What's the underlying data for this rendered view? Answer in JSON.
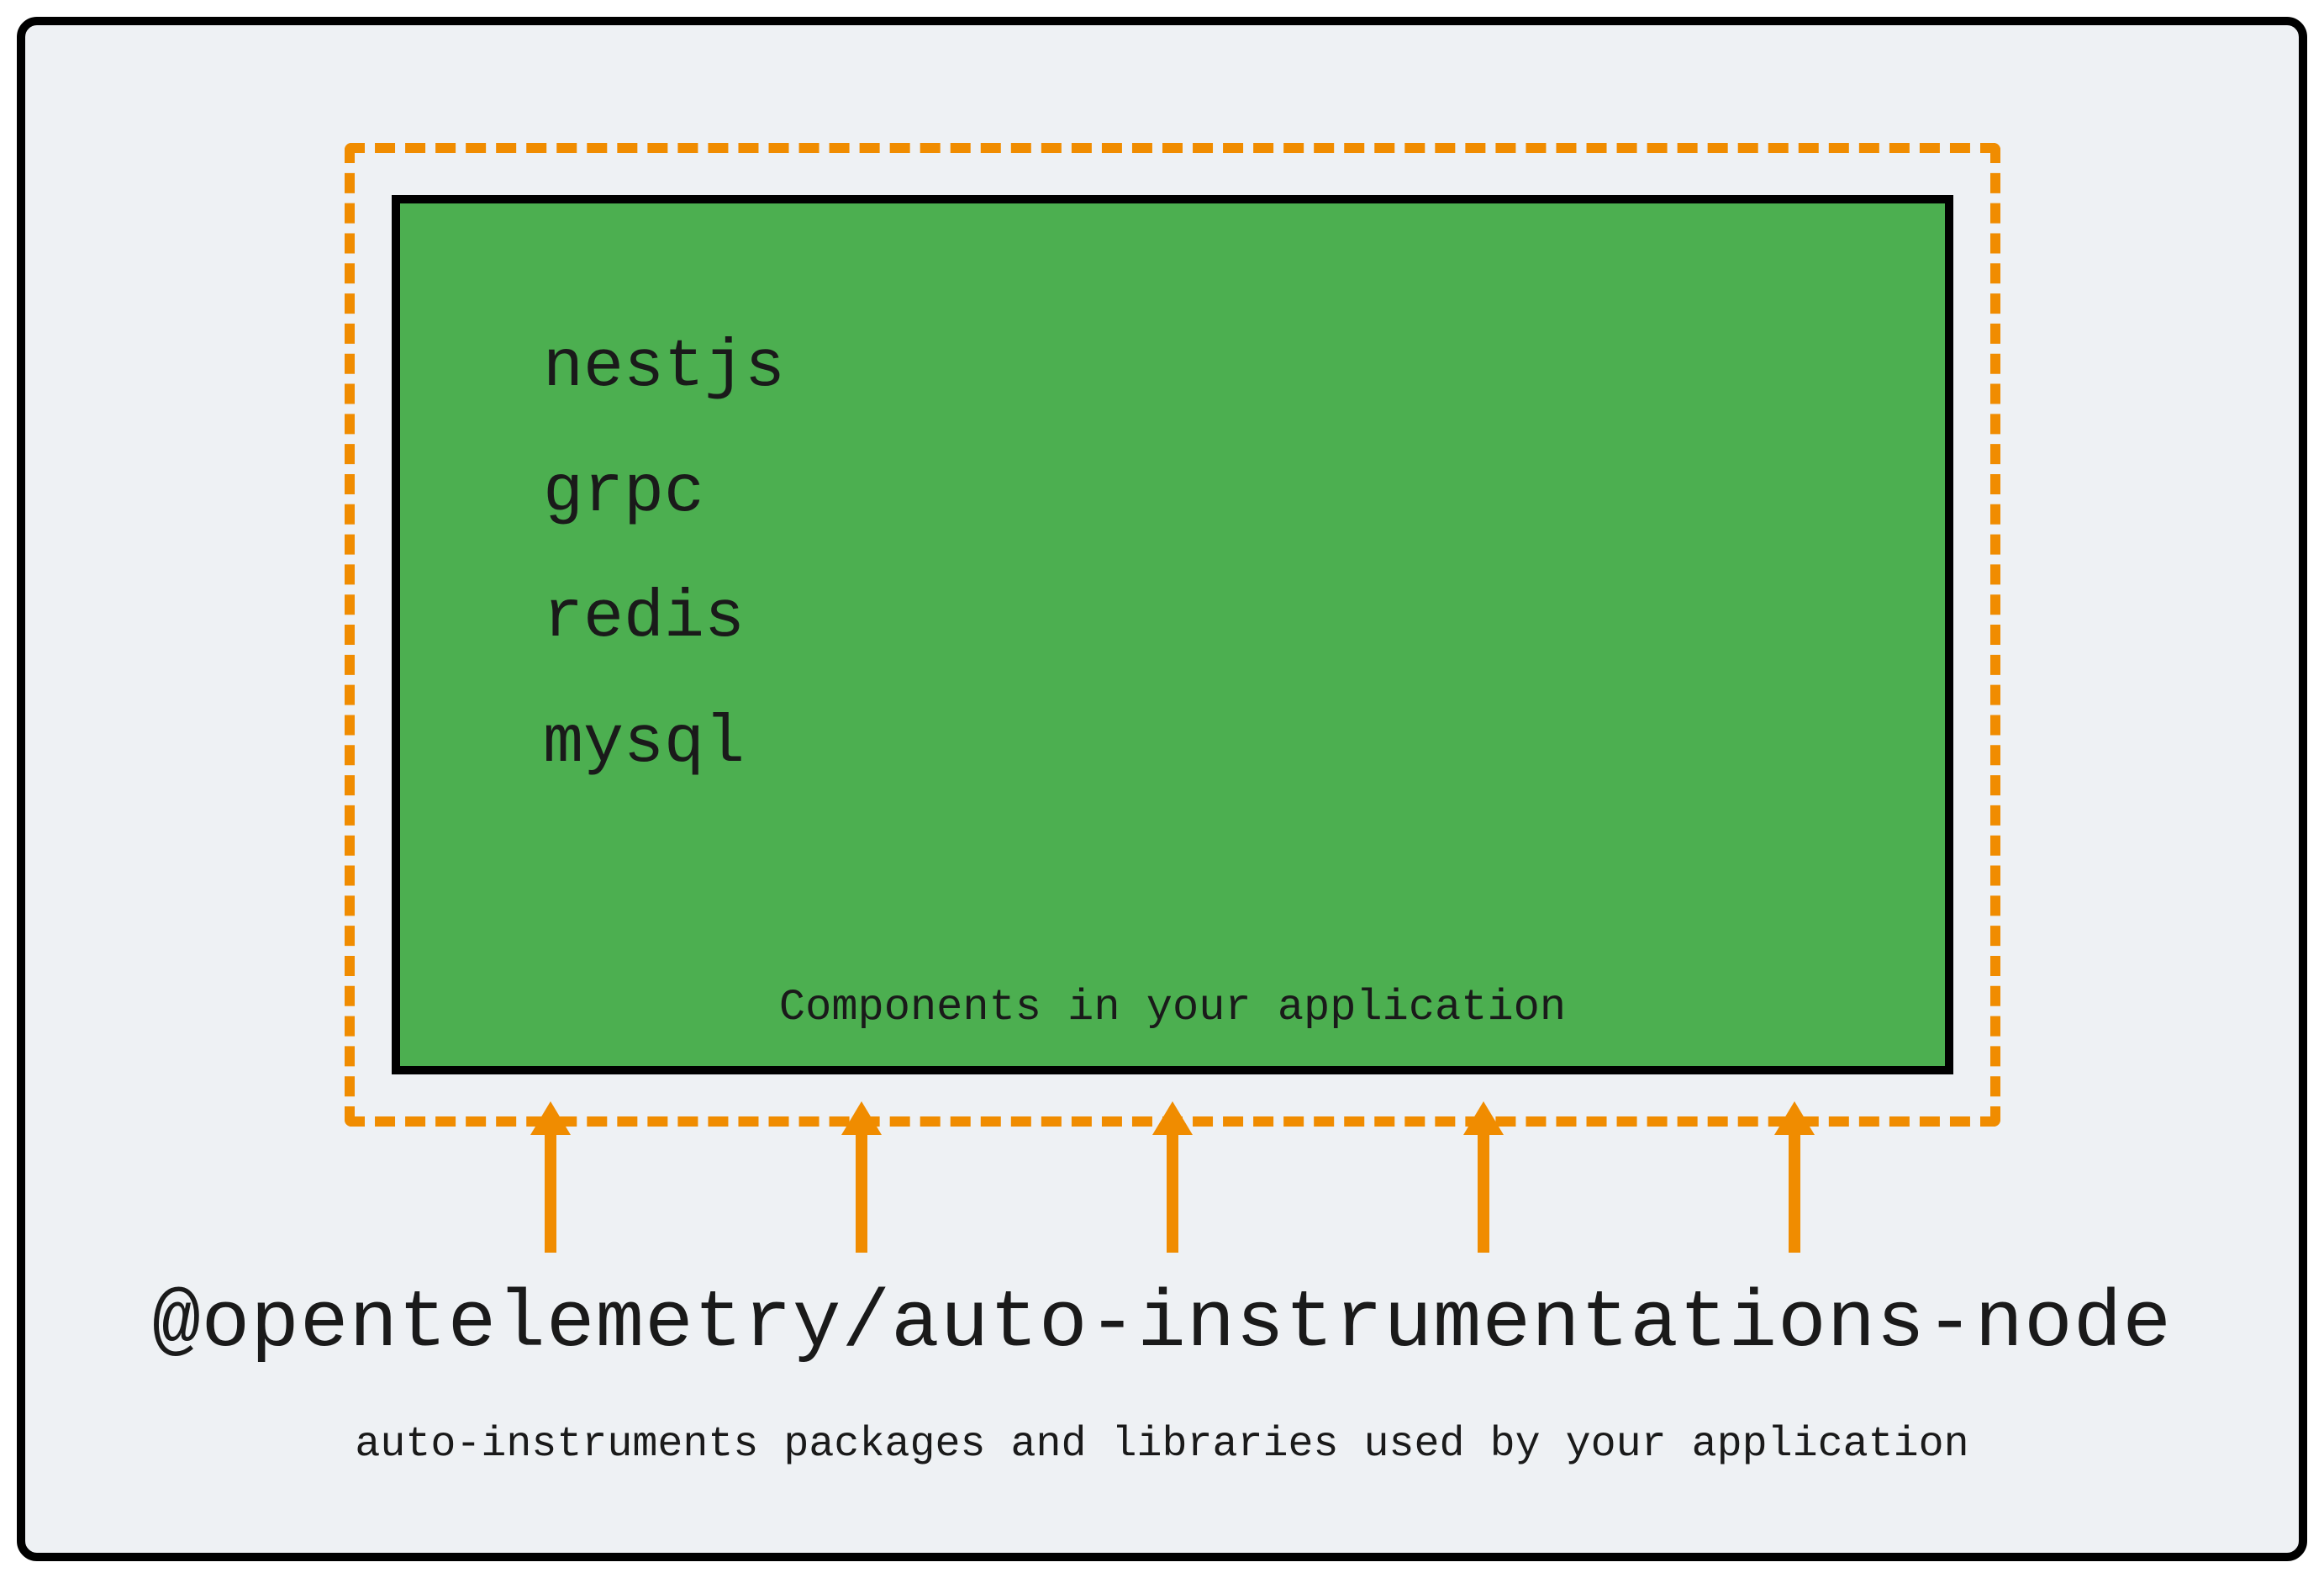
{
  "diagram": {
    "components_label": "Components in your application",
    "components": [
      "nestjs",
      "grpc",
      "redis",
      "mysql"
    ],
    "package_name": "@opentelemetry/auto-instrumentations-node",
    "package_description": "auto-instruments packages and libraries used by your application",
    "colors": {
      "background": "#eef1f4",
      "inner_box": "#4caf50",
      "dashed_border": "#f08c00",
      "arrows": "#f08c00",
      "frame": "#000000"
    },
    "arrow_count": 5
  }
}
